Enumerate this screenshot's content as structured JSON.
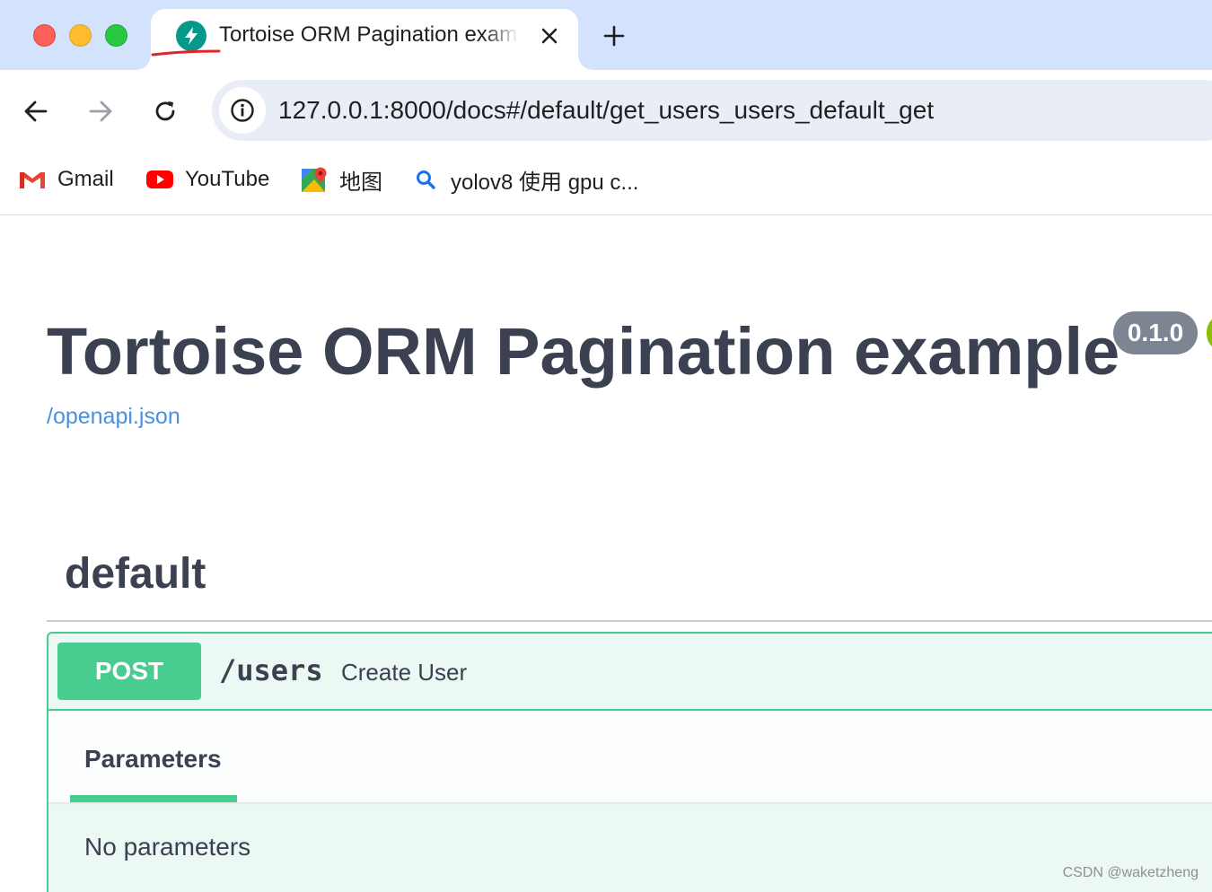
{
  "window": {
    "traffic_lights": {
      "close": "#fe5f57",
      "minimize": "#febc2e",
      "zoom": "#28c840"
    }
  },
  "tab": {
    "title": "Tortoise ORM Pagination example",
    "favicon": "fastapi-logo-icon",
    "close_icon": "close-icon",
    "new_tab_icon": "plus-icon"
  },
  "toolbar": {
    "back_icon": "arrow-left-icon",
    "forward_icon": "arrow-right-icon",
    "reload_icon": "reload-icon",
    "site_info_icon": "info-icon",
    "url": "127.0.0.1:8000/docs#/default/get_users_users_default_get"
  },
  "bookmarks": [
    {
      "label": "Gmail",
      "icon": "gmail-icon"
    },
    {
      "label": "YouTube",
      "icon": "youtube-icon"
    },
    {
      "label": "地图",
      "icon": "google-maps-icon"
    },
    {
      "label": "yolov8 使用 gpu c...",
      "icon": "search-icon"
    }
  ],
  "page": {
    "title": "Tortoise ORM Pagination example",
    "version": "0.1.0",
    "openapi_link": "/openapi.json"
  },
  "section": {
    "tag": "default",
    "operation": {
      "method": "POST",
      "path": "/users",
      "summary": "Create User",
      "tab_label": "Parameters",
      "no_params_text": "No parameters"
    }
  },
  "colors": {
    "post": "#49cc90",
    "post_bg": "#ecf8f3",
    "link": "#4990e2",
    "text": "#3b4151",
    "tabbar": "#d3e3fd"
  },
  "watermark": "CSDN @waketzheng"
}
